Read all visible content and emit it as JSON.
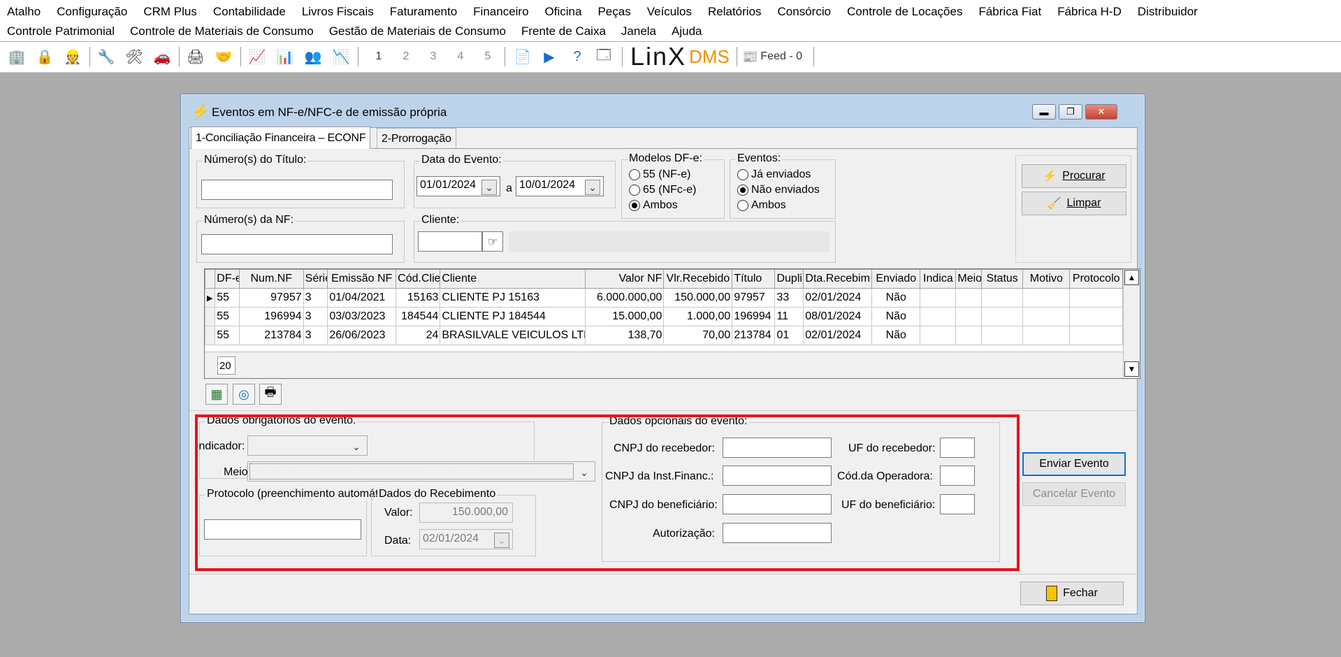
{
  "menu": {
    "row1": [
      "Atalho",
      "Configuração",
      "CRM Plus",
      "Contabilidade",
      "Livros Fiscais",
      "Faturamento",
      "Financeiro",
      "Oficina",
      "Peças",
      "Veículos",
      "Relatórios",
      "Consórcio",
      "Controle de Locações",
      "Fábrica Fiat",
      "Fábrica H-D",
      "Distribuidor"
    ],
    "row2": [
      "Controle Patrimonial",
      "Controle de Materiais de Consumo",
      "Gestão de Materiais de Consumo",
      "Frente de Caixa",
      "Janela",
      "Ajuda"
    ]
  },
  "toolbar": {
    "pages": [
      "1",
      "2",
      "3",
      "4",
      "5"
    ],
    "logo_linx": "LinX",
    "logo_dms": "DMS",
    "feed_label": "Feed - 0"
  },
  "window": {
    "title": "Eventos em NF-e/NFC-e de emissão própria",
    "minimize": "▬",
    "restore": "❐",
    "close": "✕"
  },
  "tabs": [
    {
      "label": "1-Conciliação Financeira – ECONF",
      "active": true
    },
    {
      "label": "2-Prorrogação",
      "active": false
    }
  ],
  "filters": {
    "titulo_label": "Número(s) do Título:",
    "titulo_value": "",
    "data_evento_label": "Data do Evento:",
    "data_inicio": "01/01/2024",
    "data_sep": "a",
    "data_fim": "10/01/2024",
    "nf_label": "Número(s) da NF:",
    "nf_value": "",
    "cliente_label": "Cliente:",
    "cliente_value": "",
    "cliente_nome": "",
    "modelos_label": "Modelos DF-e:",
    "modelos": [
      {
        "label": "55 (NF-e)",
        "checked": false
      },
      {
        "label": "65 (NFc-e)",
        "checked": false
      },
      {
        "label": "Ambos",
        "checked": true
      }
    ],
    "eventos_label": "Eventos:",
    "eventos": [
      {
        "label": "Já enviados",
        "checked": false
      },
      {
        "label": "Não enviados",
        "checked": true
      },
      {
        "label": "Ambos",
        "checked": false
      }
    ]
  },
  "actions": {
    "procurar": "Procurar",
    "limpar": "Limpar",
    "enviar": "Enviar Evento",
    "cancelar": "Cancelar Evento",
    "fechar": "Fechar"
  },
  "grid": {
    "columns": [
      "DF-e",
      "Num.NF",
      "Série",
      "Emissão NF",
      "Cód.Cliente",
      "Cliente",
      "Valor NF",
      "Vlr.Recebido",
      "Título",
      "Dupli",
      "Dta.Recebim",
      "Enviado",
      "Indica",
      "Meio",
      "Status",
      "Motivo",
      "Protocolo"
    ],
    "rows": [
      [
        "55",
        "97957",
        "3",
        "01/04/2021",
        "15163",
        "CLIENTE PJ 15163",
        "6.000.000,00",
        "150.000,00",
        "97957",
        "33",
        "02/01/2024",
        "Não",
        "",
        "",
        "",
        "",
        ""
      ],
      [
        "55",
        "196994",
        "3",
        "03/03/2023",
        "184544",
        "CLIENTE PJ 184544",
        "15.000,00",
        "1.000,00",
        "196994",
        "11",
        "08/01/2024",
        "Não",
        "",
        "",
        "",
        "",
        ""
      ],
      [
        "55",
        "213784",
        "3",
        "26/06/2023",
        "24",
        "BRASILVALE VEICULOS LTDA",
        "138,70",
        "70,00",
        "213784",
        "01",
        "02/01/2024",
        "Não",
        "",
        "",
        "",
        "",
        ""
      ]
    ],
    "footer_count": "20"
  },
  "obrigatorios": {
    "label": "Dados obrigatórios do evento.",
    "indicador_label": "Indicador:",
    "indicador_value": "",
    "meio_label": "Meio:",
    "meio_value": ""
  },
  "protocolo": {
    "label": "Protocolo (preenchimento automático)",
    "value": ""
  },
  "recebimento": {
    "label": "Dados do Recebimento",
    "valor_label": "Valor:",
    "valor_value": "150.000,00",
    "data_label": "Data:",
    "data_value": "02/01/2024"
  },
  "opcionais": {
    "label": "Dados opcionais do evento:",
    "cnpj_recebedor": "CNPJ do recebedor:",
    "cnpj_inst": "CNPJ da Inst.Financ.:",
    "cnpj_benef": "CNPJ do beneficiário:",
    "autorizacao": "Autorização:",
    "uf_recebedor": "UF do recebedor:",
    "cod_operadora": "Cód.da Operadora:",
    "uf_benef": "UF do beneficiário:"
  },
  "colors": {
    "highlight": "#e8121c",
    "window_frame": "#bdd3ea"
  }
}
